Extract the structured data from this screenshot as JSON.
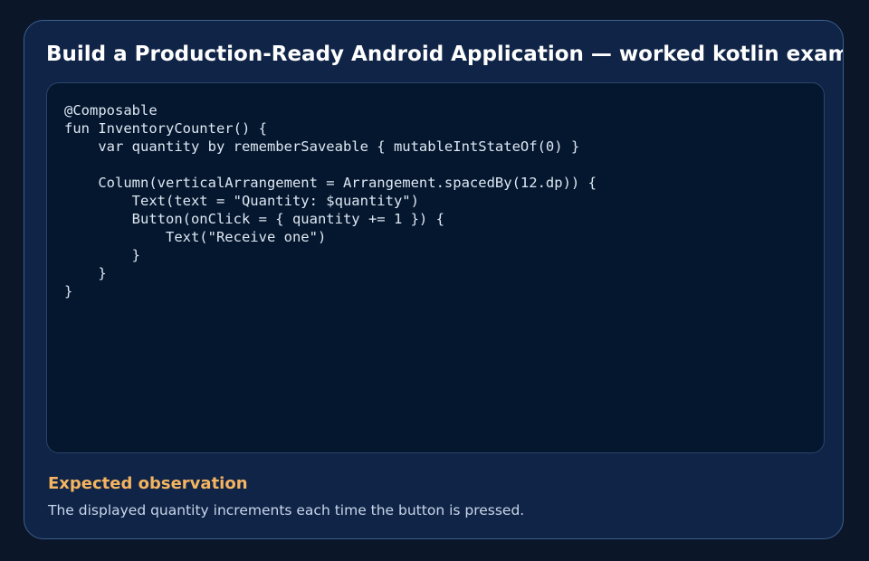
{
  "card": {
    "title": "Build a Production-Ready Android Application — worked kotlin example",
    "code": "@Composable\nfun InventoryCounter() {\n    var quantity by rememberSaveable { mutableIntStateOf(0) }\n\n    Column(verticalArrangement = Arrangement.spacedBy(12.dp)) {\n        Text(text = \"Quantity: $quantity\")\n        Button(onClick = { quantity += 1 }) {\n            Text(\"Receive one\")\n        }\n    }\n}",
    "observation_heading": "Expected observation",
    "observation_text": "The displayed quantity increments each time the button is pressed."
  },
  "colors": {
    "background": "#0b1628",
    "card": "#0f2447",
    "code_panel": "#04172e",
    "accent_heading": "#f5b460"
  }
}
